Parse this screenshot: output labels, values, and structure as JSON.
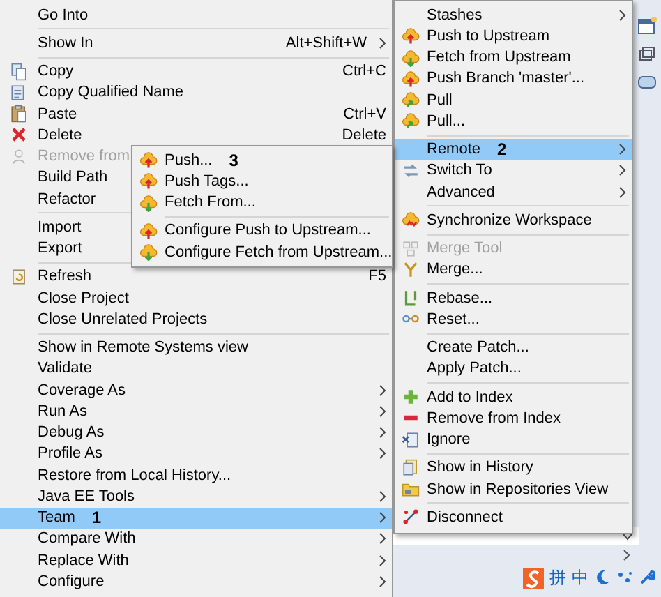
{
  "main_menu": {
    "items": [
      {
        "kind": "item",
        "label": "Go Into",
        "selected": false,
        "disabled": false
      },
      {
        "kind": "separator"
      },
      {
        "kind": "item",
        "label": "Show In",
        "shortcut": "Alt+Shift+W",
        "submenu": true,
        "selected": false,
        "disabled": false
      },
      {
        "kind": "separator"
      },
      {
        "kind": "item",
        "label": "Copy",
        "shortcut": "Ctrl+C",
        "selected": false,
        "disabled": false
      },
      {
        "kind": "item",
        "label": "Copy Qualified Name",
        "selected": false,
        "disabled": false
      },
      {
        "kind": "item",
        "label": "Paste",
        "shortcut": "Ctrl+V",
        "selected": false,
        "disabled": false
      },
      {
        "kind": "item",
        "label": "Delete",
        "shortcut": "Delete",
        "selected": false,
        "disabled": false
      },
      {
        "kind": "item",
        "label": "Remove from",
        "selected": false,
        "disabled": true
      },
      {
        "kind": "item",
        "label": "Build Path",
        "selected": false,
        "disabled": false
      },
      {
        "kind": "item",
        "label": "Refactor",
        "selected": false,
        "disabled": false
      },
      {
        "kind": "separator"
      },
      {
        "kind": "item",
        "label": "Import",
        "selected": false,
        "disabled": false
      },
      {
        "kind": "item",
        "label": "Export",
        "selected": false,
        "disabled": false
      },
      {
        "kind": "separator"
      },
      {
        "kind": "item",
        "label": "Refresh",
        "shortcut": "F5",
        "selected": false,
        "disabled": false
      },
      {
        "kind": "item",
        "label": "Close Project",
        "selected": false,
        "disabled": false
      },
      {
        "kind": "item",
        "label": "Close Unrelated Projects",
        "selected": false,
        "disabled": false
      },
      {
        "kind": "separator"
      },
      {
        "kind": "item",
        "label": "Show in Remote Systems view",
        "selected": false,
        "disabled": false
      },
      {
        "kind": "item",
        "label": "Validate",
        "selected": false,
        "disabled": false
      },
      {
        "kind": "item",
        "label": "Coverage As",
        "submenu": true,
        "selected": false,
        "disabled": false
      },
      {
        "kind": "item",
        "label": "Run As",
        "submenu": true,
        "selected": false,
        "disabled": false
      },
      {
        "kind": "item",
        "label": "Debug As",
        "submenu": true,
        "selected": false,
        "disabled": false
      },
      {
        "kind": "item",
        "label": "Profile As",
        "submenu": true,
        "selected": false,
        "disabled": false
      },
      {
        "kind": "item",
        "label": "Restore from Local History...",
        "selected": false,
        "disabled": false
      },
      {
        "kind": "item",
        "label": "Java EE Tools",
        "submenu": true,
        "selected": false,
        "disabled": false
      },
      {
        "kind": "item",
        "label": "Team",
        "annotation": "1",
        "submenu": true,
        "selected": true,
        "disabled": false
      },
      {
        "kind": "item",
        "label": "Compare With",
        "submenu": true,
        "selected": false,
        "disabled": false
      },
      {
        "kind": "item",
        "label": "Replace With",
        "submenu": true,
        "selected": false,
        "disabled": false
      },
      {
        "kind": "item",
        "label": "Configure",
        "submenu": true,
        "selected": false,
        "disabled": false
      }
    ]
  },
  "team_menu": {
    "items": [
      {
        "kind": "item",
        "label": "Stashes",
        "submenu": true,
        "selected": false,
        "disabled": false
      },
      {
        "kind": "item",
        "label": "Push to Upstream",
        "selected": false,
        "disabled": false
      },
      {
        "kind": "item",
        "label": "Fetch from Upstream",
        "selected": false,
        "disabled": false
      },
      {
        "kind": "item",
        "label": "Push Branch 'master'...",
        "selected": false,
        "disabled": false
      },
      {
        "kind": "item",
        "label": "Pull",
        "selected": false,
        "disabled": false
      },
      {
        "kind": "item",
        "label": "Pull...",
        "selected": false,
        "disabled": false
      },
      {
        "kind": "separator"
      },
      {
        "kind": "item",
        "label": "Remote",
        "annotation": "2",
        "submenu": true,
        "selected": true,
        "disabled": false
      },
      {
        "kind": "item",
        "label": "Switch To",
        "submenu": true,
        "selected": false,
        "disabled": false
      },
      {
        "kind": "item",
        "label": "Advanced",
        "submenu": true,
        "selected": false,
        "disabled": false
      },
      {
        "kind": "separator"
      },
      {
        "kind": "item",
        "label": "Synchronize Workspace",
        "selected": false,
        "disabled": false
      },
      {
        "kind": "separator"
      },
      {
        "kind": "item",
        "label": "Merge Tool",
        "selected": false,
        "disabled": true
      },
      {
        "kind": "item",
        "label": "Merge...",
        "selected": false,
        "disabled": false
      },
      {
        "kind": "separator"
      },
      {
        "kind": "item",
        "label": "Rebase...",
        "selected": false,
        "disabled": false
      },
      {
        "kind": "item",
        "label": "Reset...",
        "selected": false,
        "disabled": false
      },
      {
        "kind": "separator"
      },
      {
        "kind": "item",
        "label": "Create Patch...",
        "selected": false,
        "disabled": false
      },
      {
        "kind": "item",
        "label": "Apply Patch...",
        "selected": false,
        "disabled": false
      },
      {
        "kind": "separator"
      },
      {
        "kind": "item",
        "label": "Add to Index",
        "selected": false,
        "disabled": false
      },
      {
        "kind": "item",
        "label": "Remove from Index",
        "selected": false,
        "disabled": false
      },
      {
        "kind": "item",
        "label": "Ignore",
        "selected": false,
        "disabled": false
      },
      {
        "kind": "separator"
      },
      {
        "kind": "item",
        "label": "Show in History",
        "selected": false,
        "disabled": false
      },
      {
        "kind": "item",
        "label": "Show in Repositories View",
        "selected": false,
        "disabled": false
      },
      {
        "kind": "separator"
      },
      {
        "kind": "item",
        "label": "Disconnect",
        "selected": false,
        "disabled": false
      }
    ]
  },
  "remote_menu": {
    "items": [
      {
        "kind": "item",
        "label": "Push...",
        "annotation": "3",
        "selected": false,
        "disabled": false
      },
      {
        "kind": "item",
        "label": "Push Tags...",
        "selected": false,
        "disabled": false
      },
      {
        "kind": "item",
        "label": "Fetch From...",
        "selected": false,
        "disabled": false
      },
      {
        "kind": "separator"
      },
      {
        "kind": "item",
        "label": "Configure Push to Upstream...",
        "selected": false,
        "disabled": false
      },
      {
        "kind": "item",
        "label": "Configure Fetch from Upstream...",
        "selected": false,
        "disabled": false
      }
    ]
  },
  "input_toolbar": {
    "items": [
      "拼",
      "中"
    ]
  }
}
